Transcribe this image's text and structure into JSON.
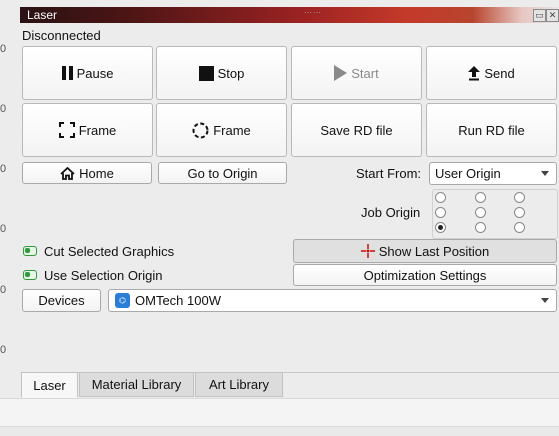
{
  "window": {
    "title": "Laser",
    "title_buttons": [
      "▭",
      "✕"
    ]
  },
  "left_ruler": [
    "0",
    "0",
    "0",
    "0",
    "0",
    "0"
  ],
  "status": {
    "text": "Disconnected"
  },
  "buttons": {
    "pause": "Pause",
    "stop": "Stop",
    "start": "Start",
    "send": "Send",
    "frame_square": "Frame",
    "frame_circle": "Frame",
    "save_rd": "Save RD file",
    "run_rd": "Run RD file",
    "home": "Home",
    "go_to_origin": "Go to Origin"
  },
  "start_from": {
    "label": "Start From:",
    "value": "User Origin"
  },
  "job_origin": {
    "label": "Job Origin",
    "selected_index": 6
  },
  "options": {
    "cut_selected": "Cut Selected Graphics",
    "use_selection_origin": "Use Selection Origin",
    "show_last_position": "Show Last Position",
    "optimization_settings": "Optimization Settings"
  },
  "devices": {
    "button_label": "Devices",
    "selected_device": "OMTech 100W"
  },
  "tabs": [
    {
      "label": "Laser",
      "active": true
    },
    {
      "label": "Material Library",
      "active": false
    },
    {
      "label": "Art Library",
      "active": false
    }
  ],
  "colors": {
    "accent_green": "#2e9a3a",
    "crosshair_red": "#cc1111",
    "device_blue": "#2a7ed6"
  }
}
